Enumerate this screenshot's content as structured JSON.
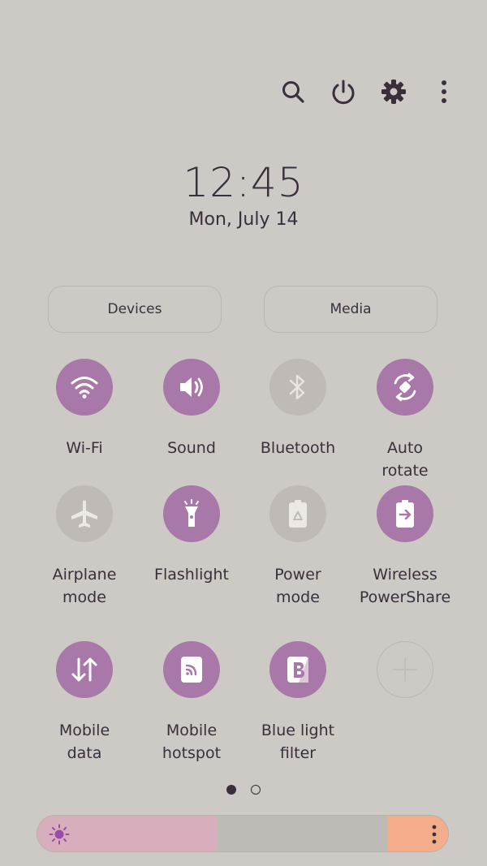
{
  "clock": {
    "time": "12:45",
    "date": "Mon, July 14"
  },
  "topbar": {
    "icons": [
      "search-icon",
      "power-icon",
      "gear-icon",
      "more-vert-icon"
    ]
  },
  "panels": {
    "devices_label": "Devices",
    "media_label": "Media"
  },
  "tiles": [
    {
      "l1": "Wi-Fi",
      "l2": "",
      "icon": "wifi-icon",
      "state": "on"
    },
    {
      "l1": "Sound",
      "l2": "",
      "icon": "speaker-icon",
      "state": "on"
    },
    {
      "l1": "Bluetooth",
      "l2": "",
      "icon": "bluetooth-icon",
      "state": "off"
    },
    {
      "l1": "Auto",
      "l2": "rotate",
      "icon": "rotate-icon",
      "state": "on"
    },
    {
      "l1": "Airplane",
      "l2": "mode",
      "icon": "airplane-icon",
      "state": "off"
    },
    {
      "l1": "Flashlight",
      "l2": "",
      "icon": "flashlight-icon",
      "state": "on"
    },
    {
      "l1": "Power",
      "l2": "mode",
      "icon": "battery-recycle-icon",
      "state": "off"
    },
    {
      "l1": "Wireless",
      "l2": "PowerShare",
      "icon": "battery-share-icon",
      "state": "on"
    },
    {
      "l1": "Mobile",
      "l2": "data",
      "icon": "data-arrows-icon",
      "state": "on"
    },
    {
      "l1": "Mobile",
      "l2": "hotspot",
      "icon": "hotspot-icon",
      "state": "on"
    },
    {
      "l1": "Blue light",
      "l2": "filter",
      "icon": "blue-light-icon",
      "state": "on"
    }
  ],
  "pager": {
    "pages": 2,
    "current": 1
  },
  "brightness": {
    "colors": {
      "left": "#d8aebd",
      "middle": "#bdbbb6",
      "right": "#f4ad8b"
    }
  },
  "colors": {
    "accent": "#a878a8",
    "background": "#cdc9c4",
    "inactive": "#bfbab5",
    "text": "#3a2f3a"
  }
}
